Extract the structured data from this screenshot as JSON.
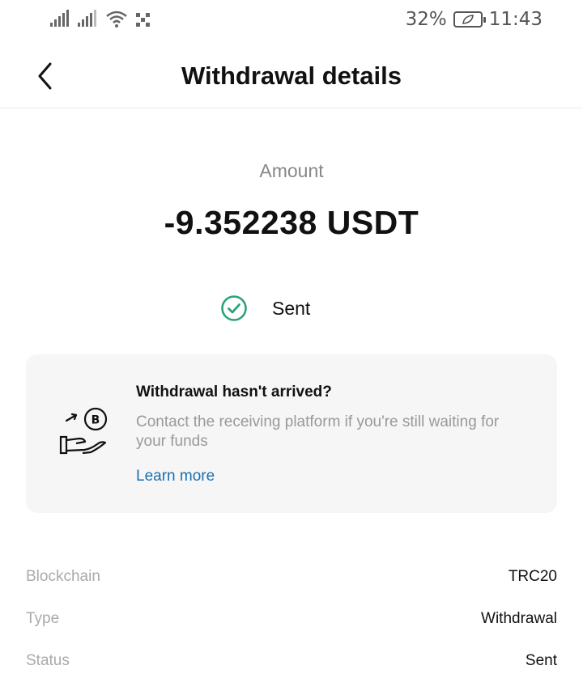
{
  "status_bar": {
    "battery": "32%",
    "time": "11:43"
  },
  "header": {
    "title": "Withdrawal details"
  },
  "amount": {
    "label": "Amount",
    "value": "-9.352238 USDT"
  },
  "status": {
    "text": "Sent",
    "color": "#2aa37a"
  },
  "help_card": {
    "title": "Withdrawal hasn't arrived?",
    "body": "Contact the receiving platform if you're still waiting for your funds",
    "link": "Learn more"
  },
  "details": [
    {
      "label": "Blockchain",
      "value": "TRC20"
    },
    {
      "label": "Type",
      "value": "Withdrawal"
    },
    {
      "label": "Status",
      "value": "Sent"
    }
  ]
}
